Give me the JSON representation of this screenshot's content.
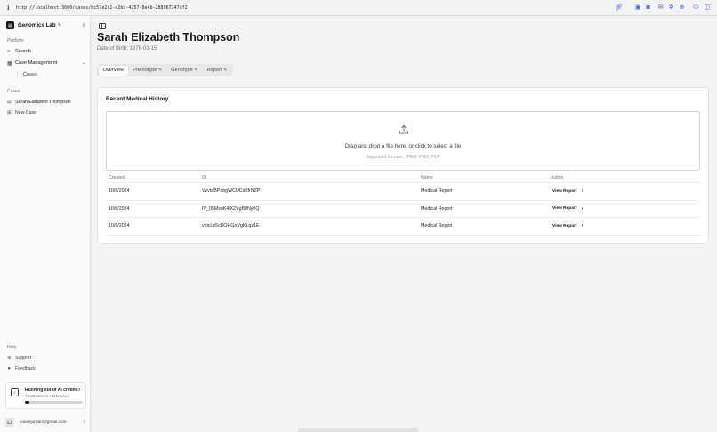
{
  "browser": {
    "url": "http://localhost:3000/cases/bc57e2c1-a2bc-4257-8e4b-288967247df2",
    "icons": [
      "link-icon",
      "camera-icon",
      "screenshot-icon",
      "mail-icon",
      "settings-icon",
      "target-icon",
      "toggle-icon",
      "panel-icon"
    ]
  },
  "sidebar": {
    "team_name": "Genomics Lab",
    "platform_label": "Platform",
    "search_label": "Search",
    "case_management_label": "Case Management",
    "cases_sub_label": "Cases",
    "cases_group_label": "Cases",
    "case_items": [
      {
        "label": "Sarah Elizabeth Thompson"
      }
    ],
    "new_case_label": "New Case",
    "help_label": "Help",
    "support_label": "Support",
    "feedback_label": "Feedback",
    "credits": {
      "title": "Running out of AI credits?",
      "usage": "79.2k tokens / 11M used",
      "fill_fraction": 0.08
    },
    "user": {
      "initials": "LJ",
      "email": "louisejordan@gmail.com"
    }
  },
  "main": {
    "patient_name": "Sarah Elizabeth Thompson",
    "dob": "Date of Birth: 1978-03-15",
    "tabs": [
      {
        "label": "Overview",
        "active": true,
        "editable": false
      },
      {
        "label": "Phenotype",
        "active": false,
        "editable": true
      },
      {
        "label": "Genotype",
        "active": false,
        "editable": true
      },
      {
        "label": "Report",
        "active": false,
        "editable": true
      }
    ],
    "history": {
      "title": "Recent Medical History",
      "dropzone_text": "Drag and drop a file here, or click to select a file",
      "dropzone_hint": "Supported formats: JPEG, PNG, PDF",
      "columns": [
        "Created",
        "ID",
        "Name",
        "Action"
      ],
      "rows": [
        {
          "created": "10/6/2024",
          "id": "VzvtaBPabgWCUCd6frNZP",
          "name": "Medical Report",
          "action": "View Report"
        },
        {
          "created": "10/6/2024",
          "id": "IV_05MsaK4lX2YgB8Ny0Q",
          "name": "Medical Report",
          "action": "View Report"
        },
        {
          "created": "10/6/2024",
          "id": "vhicLs5cDOHGnVgKLqz1E",
          "name": "Medical Report",
          "action": "View Report"
        }
      ]
    }
  },
  "colors": {
    "accent": "#18181b",
    "muted": "#71717a",
    "browser_icon": "#4b5bd0"
  }
}
